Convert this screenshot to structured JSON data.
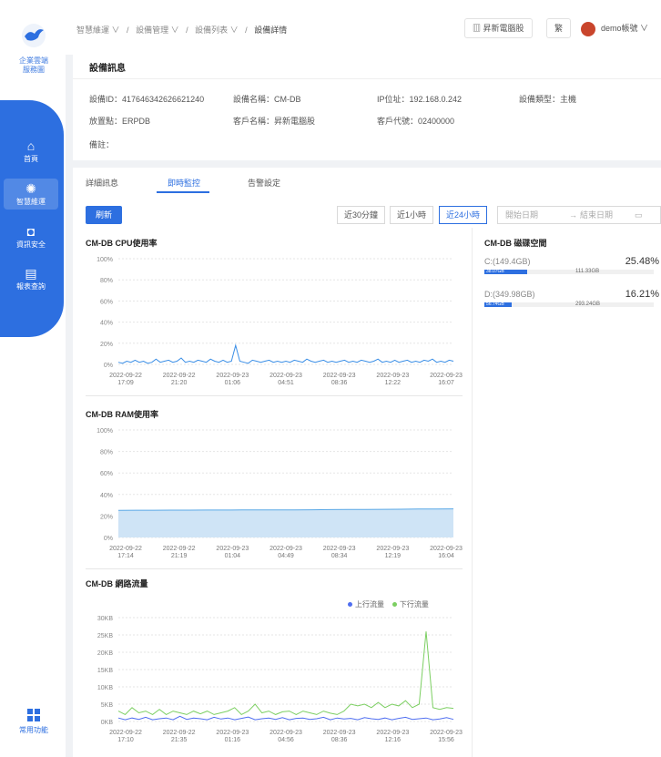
{
  "sidebar": {
    "logo_text": [
      "企業雲端",
      "服務圖"
    ],
    "items": [
      {
        "label": "首頁",
        "icon": "home-icon"
      },
      {
        "label": "智慧維運",
        "icon": "monitor-icon"
      },
      {
        "label": "資訊安全",
        "icon": "shield-icon"
      },
      {
        "label": "報表查詢",
        "icon": "report-icon"
      }
    ],
    "common_label": "常用功能"
  },
  "header": {
    "breadcrumb": [
      "智慧維運 ∨",
      "/",
      "設備管理 ∨",
      "/",
      "設備列表 ∨",
      "/",
      "設備詳情"
    ],
    "company_button": "昇新電腦股",
    "lang_button": "繁",
    "user_label": "demo帳號 ∨"
  },
  "device_info": {
    "title": "設備訊息",
    "fields": {
      "device_id": "設備ID：417646342626621240",
      "device_name": "設備名稱：CM-DB",
      "ip": "IP位址：192.168.0.242",
      "device_type": "設備類型：主機",
      "site": "放置點：ERPDB",
      "customer": "客戶名稱：昇新電腦股",
      "customer_code": "客戶代號：02400000",
      "note": "備註："
    }
  },
  "tabs": [
    "詳細訊息",
    "即時監控",
    "告警設定"
  ],
  "active_tab": 1,
  "toolbar": {
    "refresh": "刷新",
    "ranges": [
      "近30分鐘",
      "近1小時",
      "近24小時"
    ],
    "active_range": 2,
    "start_placeholder": "開始日期",
    "arrow": "→",
    "end_placeholder": "結束日期",
    "calendar_icon": "calendar-icon"
  },
  "colors": {
    "accent": "#2d6fe0",
    "upload": "#4f6ef0",
    "download": "#7ccf62",
    "area": "#cfe4f6",
    "area_line": "#5aa8e6"
  },
  "chart_data": [
    {
      "type": "line",
      "title": "CM-DB CPU使用率",
      "yticks": [
        "100%",
        "80%",
        "60%",
        "40%",
        "20%",
        "0%"
      ],
      "ylim": [
        0,
        100
      ],
      "x": [
        "2022-09-22 17:09",
        "2022-09-22 21:20",
        "2022-09-23 01:06",
        "2022-09-23 04:51",
        "2022-09-23 08:36",
        "2022-09-23 12:22",
        "2022-09-23 16:07"
      ],
      "series": [
        {
          "values": [
            2,
            1,
            3,
            2,
            4,
            2,
            3,
            1,
            2,
            5,
            2,
            3,
            4,
            2,
            3,
            6,
            2,
            3,
            2,
            4,
            3,
            2,
            5,
            3,
            2,
            4,
            2,
            3,
            18,
            3,
            2,
            1,
            4,
            3,
            2,
            3,
            4,
            2,
            3,
            2,
            3,
            2,
            4,
            3,
            2,
            5,
            3,
            2,
            3,
            4,
            2,
            3,
            2,
            3,
            4,
            2,
            3,
            2,
            4,
            3,
            2,
            3,
            5,
            2,
            3,
            2,
            4,
            2,
            3,
            4,
            2,
            3,
            2,
            4,
            3,
            5,
            2,
            3,
            2,
            4,
            3
          ]
        }
      ]
    },
    {
      "type": "area",
      "title": "CM-DB RAM使用率",
      "yticks": [
        "100%",
        "80%",
        "60%",
        "40%",
        "20%",
        "0%"
      ],
      "ylim": [
        0,
        100
      ],
      "x": [
        "2022-09-22 17:14",
        "2022-09-22 21:19",
        "2022-09-23 01:04",
        "2022-09-23 04:49",
        "2022-09-23 08:34",
        "2022-09-23 12:19",
        "2022-09-23 16:04"
      ],
      "series": [
        {
          "values": [
            25.2,
            25.3,
            25.3,
            25.4,
            25.4,
            25.5,
            25.5,
            25.6,
            25.6,
            25.7,
            25.7,
            25.8,
            25.9,
            26.0,
            26.1,
            26.2,
            26.3,
            26.4,
            26.5,
            26.6
          ]
        }
      ]
    },
    {
      "type": "line",
      "title": "CM-DB 網路流量",
      "yticks": [
        "30KB",
        "25KB",
        "20KB",
        "15KB",
        "10KB",
        "5KB",
        "0KB"
      ],
      "ylim": [
        0,
        30
      ],
      "legend": [
        "上行流量",
        "下行流量"
      ],
      "x": [
        "2022-09-22 17:10",
        "2022-09-22 21:35",
        "2022-09-23 01:16",
        "2022-09-23 04:56",
        "2022-09-23 08:36",
        "2022-09-23 12:16",
        "2022-09-23 15:56"
      ],
      "series": [
        {
          "name": "上行流量",
          "values": [
            1,
            0.5,
            1,
            0.6,
            1.2,
            0.5,
            0.8,
            1,
            0.5,
            1.5,
            0.6,
            1,
            0.8,
            0.5,
            1.2,
            0.7,
            1,
            0.5,
            0.9,
            1.3,
            0.5,
            0.8,
            1,
            0.6,
            1.1,
            0.5,
            0.9,
            1,
            0.6,
            0.8,
            1.2,
            0.5,
            1,
            0.7,
            0.9,
            0.5,
            1.1,
            0.8,
            0.6,
            1,
            0.5,
            0.9,
            1.2,
            0.6,
            0.8,
            1,
            0.5,
            0.7,
            1.1,
            0.6
          ]
        },
        {
          "name": "下行流量",
          "values": [
            3,
            2,
            4,
            2.5,
            3,
            2,
            3.5,
            2,
            3,
            2.5,
            2,
            3,
            2.2,
            3,
            2,
            2.5,
            3,
            4,
            2,
            3,
            5,
            2.5,
            3,
            2,
            2.8,
            3,
            2,
            3,
            2.5,
            2,
            3,
            2.4,
            2,
            3,
            5,
            4.5,
            5,
            4,
            5.5,
            4,
            5,
            4.5,
            6,
            4,
            5,
            26,
            4,
            3.5,
            4,
            3.8
          ]
        }
      ]
    },
    {
      "type": "bar",
      "title": "CM-DB 磁碟空間",
      "categories": [
        "C:(149.4GB)",
        "D:(349.98GB)"
      ],
      "values": [
        25.48,
        16.21
      ],
      "percent_labels": [
        "25.48%",
        "16.21%"
      ],
      "used_labels": [
        "38.07GB",
        "56.74GB"
      ],
      "free_labels": [
        "111.33GB",
        "293.24GB"
      ]
    }
  ]
}
